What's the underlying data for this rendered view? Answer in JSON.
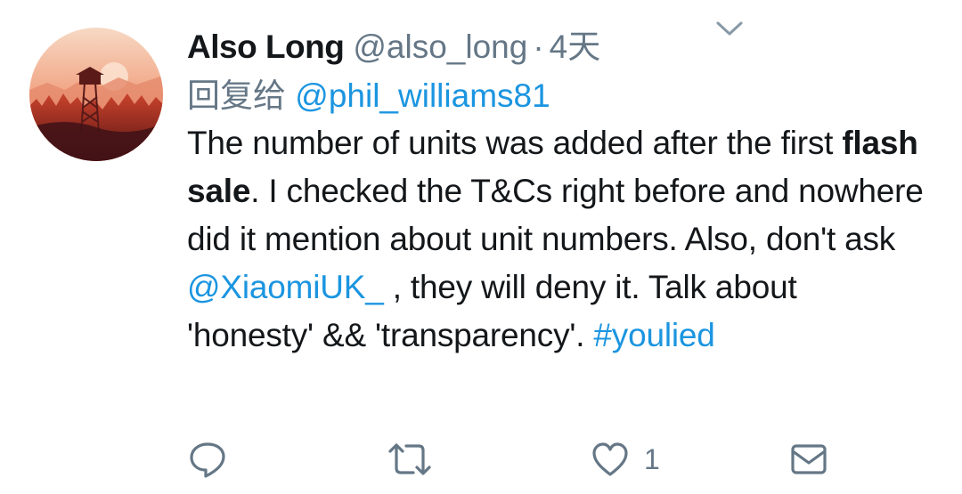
{
  "tweet": {
    "display_name": "Also Long",
    "handle": "@also_long",
    "separator": "·",
    "time": "4天",
    "reply_prefix": "回复给",
    "reply_to": "@phil_williams81",
    "text": {
      "p1": "The number of units was added after the first ",
      "bold": "flash sale",
      "p2": ". I checked the T&Cs right before and nowhere did it mention about unit numbers. Also, don't ask ",
      "mention": "@XiaomiUK_",
      "p3": " , they will deny it. Talk about 'honesty' && 'transparency'. ",
      "hashtag": "#youlied"
    }
  },
  "actions": {
    "reply_icon": "reply-icon",
    "retweet_icon": "retweet-icon",
    "like_icon": "heart-icon",
    "like_count": "1",
    "dm_icon": "envelope-icon"
  },
  "colors": {
    "text": "#14171a",
    "secondary": "#657786",
    "link": "#1b95e0",
    "icon": "#657786"
  }
}
